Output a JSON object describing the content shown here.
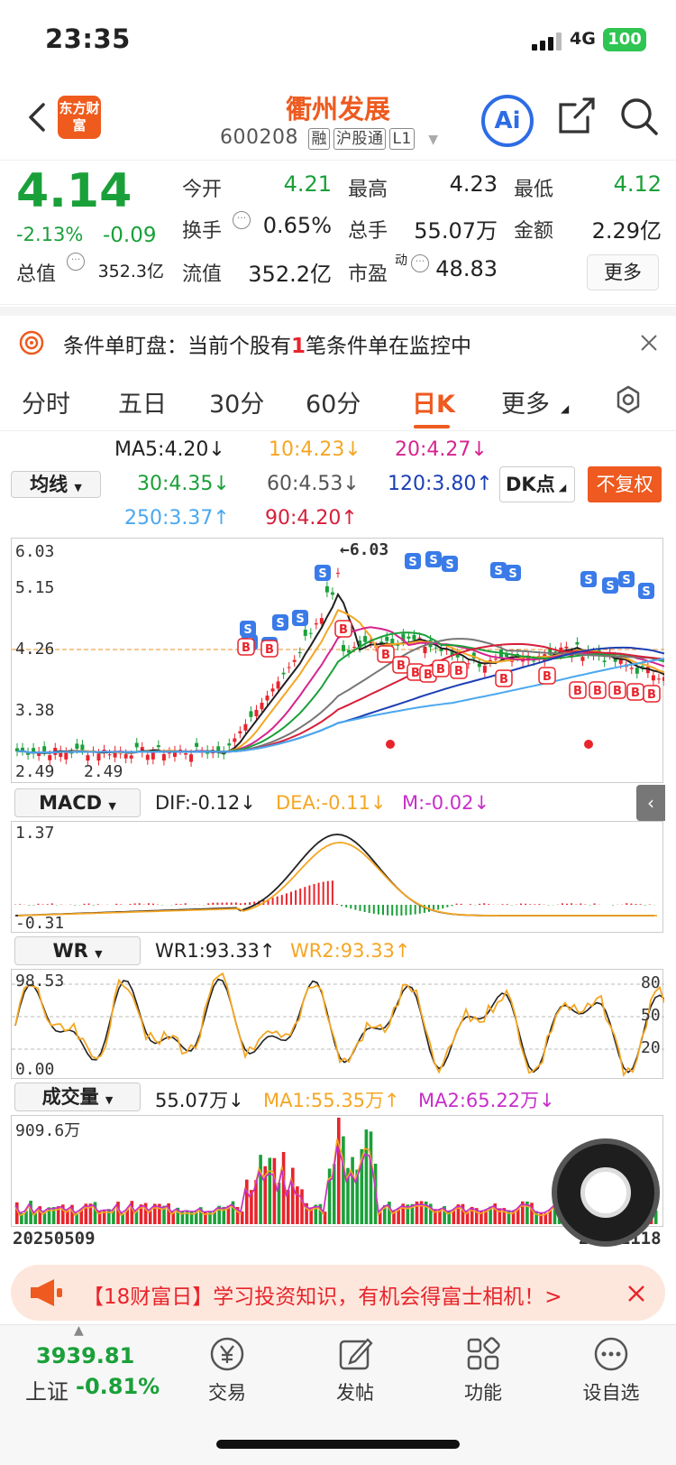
{
  "status": {
    "time": "23:35",
    "network": "4G",
    "battery": "100"
  },
  "header": {
    "logo": "东方财富",
    "title": "衢州发展",
    "code": "600208",
    "tags": [
      "融",
      "沪股通",
      "L1"
    ],
    "ai_label": "Ai"
  },
  "quote": {
    "price": "4.14",
    "pct": "-2.13%",
    "change": "-0.09",
    "open_label": "今开",
    "open": "4.21",
    "high_label": "最高",
    "high": "4.23",
    "low_label": "最低",
    "low": "4.12",
    "turnover_label": "换手",
    "turnover": "0.65%",
    "volume_label": "总手",
    "volume": "55.07万",
    "amount_label": "金额",
    "amount": "2.29亿",
    "mcap_label": "总值",
    "mcap": "352.3亿",
    "float_label": "流值",
    "float": "352.2亿",
    "pe_label": "市盈",
    "pe_sup": "动",
    "pe": "48.83",
    "more_label": "更多"
  },
  "alert": {
    "prefix": "条件单盯盘：当前个股有",
    "count": "1",
    "suffix": "笔条件单在监控中"
  },
  "tabs": [
    "分时",
    "五日",
    "30分",
    "60分",
    "日K",
    "更多"
  ],
  "active_tab": 4,
  "ma": {
    "selector": "均线",
    "items": [
      {
        "text": "MA5:4.20↓",
        "color": "#222"
      },
      {
        "text": "10:4.23↓",
        "color": "#f5a623"
      },
      {
        "text": "20:4.27↓",
        "color": "#d6248f"
      },
      {
        "text": "30:4.35↓",
        "color": "#1aa039"
      },
      {
        "text": "60:4.53↓",
        "color": "#555"
      },
      {
        "text": "120:3.80↑",
        "color": "#1c3fb5"
      },
      {
        "text": "250:3.37↑",
        "color": "#4aa8f0"
      },
      {
        "text": "90:4.20↑",
        "color": "#d6203a"
      }
    ],
    "dk": "DK点",
    "fq": "不复权"
  },
  "kline": {
    "high_mark": "←6.03",
    "y_labels": [
      "6.03",
      "5.15",
      "4.26",
      "3.38",
      "2.49",
      "2.49"
    ]
  },
  "macd": {
    "selector": "MACD",
    "dif": "DIF:-0.12↓",
    "dea": "DEA:-0.11↓",
    "m": "M:-0.02↓",
    "top": "1.37",
    "bottom": "-0.31"
  },
  "wr": {
    "selector": "WR",
    "wr1": "WR1:93.33↑",
    "wr2": "WR2:93.33↑",
    "top": "98.53",
    "bottom": "0.00",
    "levels": [
      "80",
      "50",
      "20"
    ]
  },
  "vol": {
    "selector": "成交量",
    "v": "55.07万↓",
    "ma1": "MA1:55.35万↑",
    "ma2": "MA2:65.22万↓",
    "top": "909.6万",
    "date_start": "20250509",
    "date_end": "20251118"
  },
  "banner": {
    "text": "【18财富日】学习投资知识，有机会得富士相机！>"
  },
  "bottom": {
    "index_value": "3939.81",
    "index_name": "上证",
    "index_change": "-0.81%",
    "items": [
      "交易",
      "发帖",
      "功能",
      "设自选"
    ]
  }
}
